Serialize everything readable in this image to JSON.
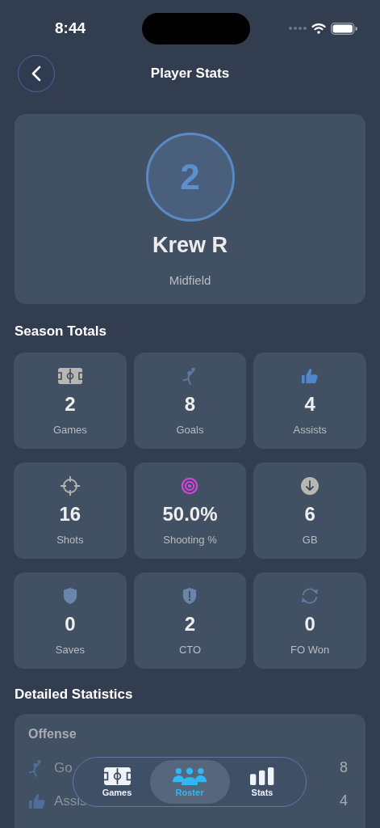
{
  "status_bar": {
    "time": "8:44"
  },
  "nav": {
    "title": "Player Stats"
  },
  "player": {
    "number": "2",
    "name": "Krew R",
    "position": "Midfield"
  },
  "season_totals": {
    "title": "Season Totals",
    "stats": [
      {
        "value": "2",
        "label": "Games"
      },
      {
        "value": "8",
        "label": "Goals"
      },
      {
        "value": "4",
        "label": "Assists"
      },
      {
        "value": "16",
        "label": "Shots"
      },
      {
        "value": "50.0%",
        "label": "Shooting %"
      },
      {
        "value": "6",
        "label": "GB"
      },
      {
        "value": "0",
        "label": "Saves"
      },
      {
        "value": "2",
        "label": "CTO"
      },
      {
        "value": "0",
        "label": "FO Won"
      }
    ]
  },
  "detailed": {
    "title": "Detailed Statistics",
    "section": "Offense",
    "rows": [
      {
        "label": "Go",
        "value": "8"
      },
      {
        "label": "Assis",
        "value": "4"
      }
    ]
  },
  "tab_bar": {
    "tabs": [
      {
        "label": "Games",
        "selected": false
      },
      {
        "label": "Roster",
        "selected": true
      },
      {
        "label": "Stats",
        "selected": false
      }
    ]
  }
}
